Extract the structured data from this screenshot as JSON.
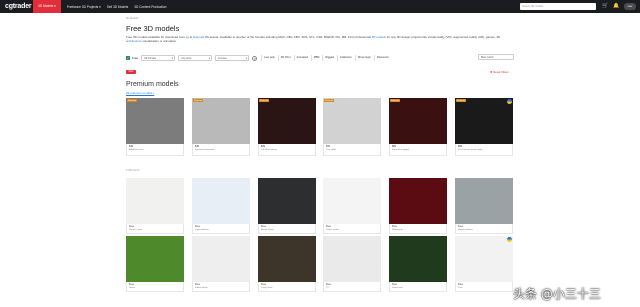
{
  "topbar": {
    "logo": "cgtrader",
    "nav": [
      "3D Models ▾",
      "Freelance 3D Projects ▾",
      "Sell 3D Models",
      "3D Content Production"
    ],
    "search_placeholder": "Search 3D models",
    "avatar_label": "user"
  },
  "breadcrumb": "3D Models",
  "title": "Free 3D models",
  "description": {
    "part1": "Free 3D models available for download from ",
    "link1": "cg",
    "part2": " to ",
    "link2": "licensed",
    "part3": " 3D assets. Available in number of file formats including MAX, OBJ, FBX, 3DS, STL, C4D, BLEND, MA, MB. Find professional ",
    "link3": "3D models",
    "part4": " for any 3D design projects like virtual reality (VR), augmented reality (AR), games, 3D ",
    "link4": "architecture",
    "part5": " visualization or animation."
  },
  "filters": {
    "free_label": "Free",
    "select1": "All formats",
    "select2": "Any price",
    "select3": "License",
    "buttons": [
      "Low poly",
      "3D Print",
      "Animated",
      "PBR",
      "Rigged",
      "Collection",
      "Show login",
      "Discounts"
    ],
    "sort": "Best match"
  },
  "reset_label": "✖ Reset Filters",
  "red_badge": "New",
  "premium": {
    "title": "Premium models",
    "link": "All premium models ›",
    "cards": [
      {
        "price": "$49",
        "name": "Astronaut suits",
        "tag": "Premium",
        "bg": "#7c7c7c",
        "flag": false
      },
      {
        "price": "$39",
        "name": "Spacesuit astronaut",
        "tag": "Premium",
        "bg": "#b9b9b9",
        "flag": false
      },
      {
        "price": "$29",
        "name": "Iron Man helmet",
        "tag": "Premium",
        "bg": "#2b1414",
        "flag": false
      },
      {
        "price": "$19",
        "name": "Coin relief",
        "tag": "Premium",
        "bg": "#d2d2d2",
        "flag": false
      },
      {
        "price": "$89",
        "name": "Superhero rigged",
        "tag": "Premium",
        "bg": "#3a1010",
        "flag": false
      },
      {
        "price": "$69",
        "name": "Sci-fi warrior game ready",
        "tag": "Premium",
        "bg": "#1a1a1a",
        "flag": true
      }
    ]
  },
  "free_section_label": "2 000 Items",
  "free_cards_row1": [
    {
      "price": "Free",
      "name": "Plants in pots",
      "bg": "#f1f1ef"
    },
    {
      "price": "Free",
      "name": "Light switches",
      "bg": "#e8eef5"
    },
    {
      "price": "Free",
      "name": "Range Rover",
      "bg": "#2c2e30"
    },
    {
      "price": "Free",
      "name": "Tennis racket",
      "bg": "#f4f4f4"
    },
    {
      "price": "Free",
      "name": "Motorcycle",
      "bg": "#5a0c12"
    },
    {
      "price": "Free",
      "name": "Modern interior",
      "bg": "#9aa2a6"
    }
  ],
  "free_cards_row2": [
    {
      "price": "Free",
      "name": "Grass",
      "bg": "#4e8a2c"
    },
    {
      "price": "Free",
      "name": "Indoor plants",
      "bg": "#eeeeee"
    },
    {
      "price": "Free",
      "name": "Living room",
      "bg": "#3d342a"
    },
    {
      "price": "Free",
      "name": "TV",
      "bg": "#eaeaea"
    },
    {
      "price": "Free",
      "name": "Green wall",
      "bg": "#1f3a1d"
    },
    {
      "price": "Free",
      "name": "Tree",
      "bg": "#f2f2f2",
      "flag": true
    }
  ],
  "watermark": "头条 @小三十三",
  "colors": {
    "accent": "#e12e3a",
    "link": "#1e7ad6",
    "premium_tag": "#d98a1b"
  }
}
